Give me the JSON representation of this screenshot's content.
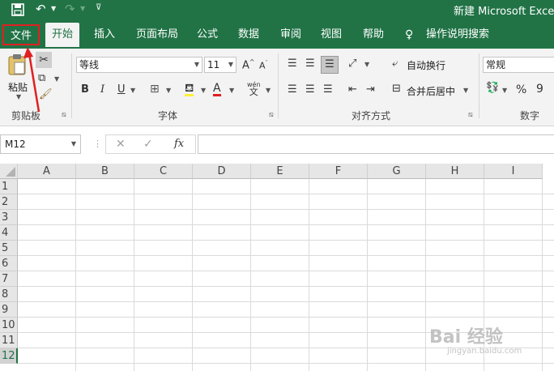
{
  "window": {
    "title": "新建 Microsoft Excel 工"
  },
  "tabs": [
    {
      "label": "文件"
    },
    {
      "label": "开始"
    },
    {
      "label": "插入"
    },
    {
      "label": "页面布局"
    },
    {
      "label": "公式"
    },
    {
      "label": "数据"
    },
    {
      "label": "审阅"
    },
    {
      "label": "视图"
    },
    {
      "label": "帮助"
    },
    {
      "label": "操作说明搜索"
    }
  ],
  "ribbon": {
    "clipboard": {
      "paste_label": "粘贴",
      "group_label": "剪贴板"
    },
    "font": {
      "font_name": "等线",
      "font_size": "11",
      "group_label": "字体",
      "bold": "B",
      "italic": "I",
      "underline": "U",
      "wen": "wén",
      "wen_char": "文"
    },
    "alignment": {
      "wrap_text": "自动换行",
      "merge_center": "合并后居中",
      "group_label": "对齐方式"
    },
    "number": {
      "format": "常规",
      "percent": "%",
      "comma": "9",
      "group_label": "数字"
    }
  },
  "formula_bar": {
    "name_box": "M12",
    "fx": "fx"
  },
  "grid": {
    "columns": [
      "A",
      "B",
      "C",
      "D",
      "E",
      "F",
      "G",
      "H",
      "I"
    ],
    "rows": [
      "1",
      "2",
      "3",
      "4",
      "5",
      "6",
      "7",
      "8",
      "9",
      "10",
      "11",
      "12"
    ],
    "active_row": "12"
  },
  "annotation": {
    "highlight_color": "#e02020"
  },
  "watermark": {
    "text": "Bai 经验",
    "sub": "jingyan.baidu.com"
  }
}
